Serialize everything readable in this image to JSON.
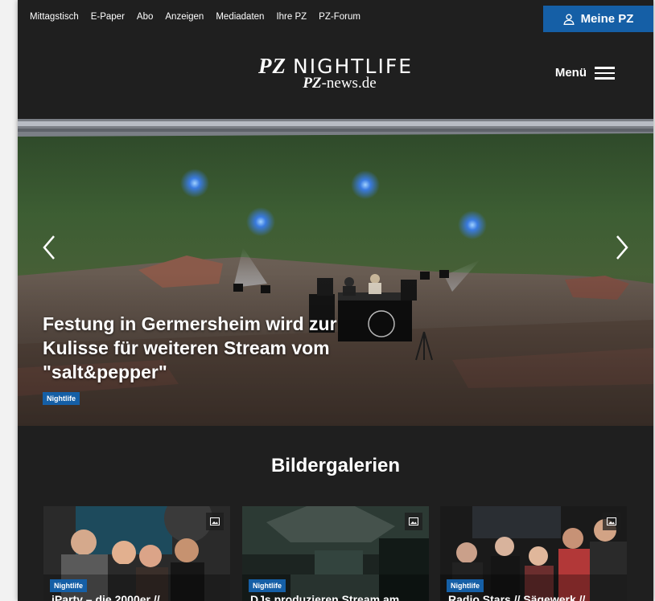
{
  "topnav": {
    "links": [
      "Mittagstisch",
      "E-Paper",
      "Abo",
      "Anzeigen",
      "Mediadaten",
      "Ihre PZ",
      "PZ-Forum"
    ],
    "account_label": "Meine PZ"
  },
  "logo": {
    "brand": "PZ",
    "name": "NIGHTLIFE",
    "site_prefix": "PZ",
    "site_suffix": "-news.de"
  },
  "menu": {
    "label": "Menü"
  },
  "hero": {
    "title": "Festung in Germersheim wird zur Kulisse für weiteren Stream vom \"salt&pepper\"",
    "badge": "Nightlife"
  },
  "gallery": {
    "heading": "Bildergalerien",
    "cards": [
      {
        "badge": "Nightlife",
        "title": "iParty – die 2000er //",
        "icon": "image-icon"
      },
      {
        "badge": "Nightlife",
        "title": "DJs produzieren Stream am",
        "icon": "image-icon"
      },
      {
        "badge": "Nightlife",
        "title": "Radio Stars // Sägewerk //",
        "icon": "image-icon"
      }
    ]
  },
  "colors": {
    "accent": "#155fa6",
    "background": "#1f1f1f"
  }
}
